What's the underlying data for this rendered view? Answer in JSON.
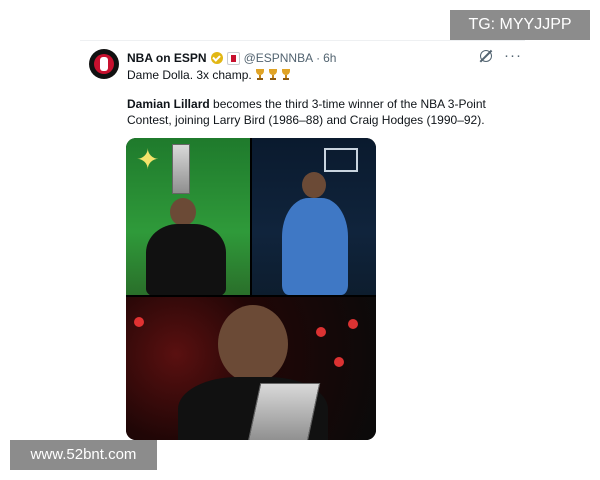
{
  "post": {
    "author_name": "NBA on ESPN",
    "handle": "@ESPNNBA",
    "separator": "·",
    "time": "6h",
    "line1": "Dame Dolla. 3x champ.",
    "trophies": [
      "trophy-icon",
      "trophy-icon",
      "trophy-icon"
    ],
    "body_bold": "Damian Lillard",
    "body_rest": " becomes the third 3-time winner of the NBA 3-Point Contest, joining Larry Bird (1986–88) and Craig Hodges (1990–92).",
    "more_label": "···"
  },
  "media": {
    "photos": [
      {
        "name": "photo-lillard-trophy"
      },
      {
        "name": "photo-lillard-celebrating"
      },
      {
        "name": "photo-lillard-closeup"
      }
    ]
  },
  "watermarks": {
    "top": "TG: MYYJJPP",
    "bottom": "www.52bnt.com"
  },
  "colors": {
    "text": "#0f1419",
    "muted": "#536471",
    "verified": "#e2b714",
    "brand": "#c8102e",
    "watermark_bg": "#8c8c8c"
  }
}
